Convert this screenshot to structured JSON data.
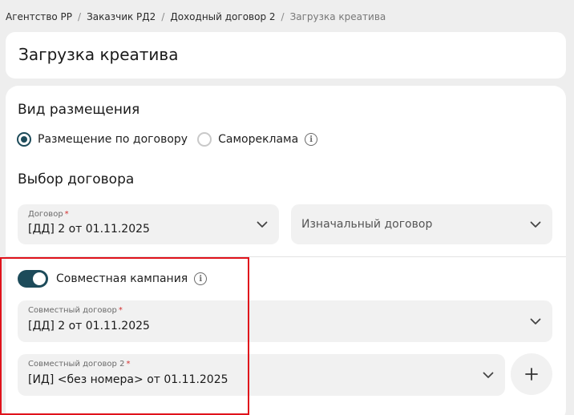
{
  "breadcrumb": {
    "items": [
      "Агентство РР",
      "Заказчик РД2",
      "Доходный договор 2"
    ],
    "current": "Загрузка креатива",
    "separator": "/"
  },
  "page_title": "Загрузка креатива",
  "placement": {
    "title": "Вид размещения",
    "options": [
      {
        "label": "Размещение по договору",
        "checked": true
      },
      {
        "label": "Самореклама",
        "checked": false
      }
    ]
  },
  "contract": {
    "title": "Выбор договора",
    "field": {
      "label": "Договор",
      "value": "[ДД] 2 от 01.11.2025"
    },
    "original_placeholder": "Изначальный договор"
  },
  "joint": {
    "toggle_label": "Совместная кампания",
    "toggle_on": true,
    "field1": {
      "label": "Совместный договор",
      "value": "[ДД] 2 от 01.11.2025"
    },
    "field2": {
      "label": "Совместный договор 2",
      "value": "[ИД] <без номера> от 01.11.2025"
    }
  },
  "required_mark": "*",
  "colors": {
    "accent": "#1d4b5a",
    "required": "#d32f2f",
    "highlight": "#e0121b"
  },
  "icons": {
    "info": "info-icon",
    "chevron": "chevron-down-icon",
    "plus": "plus-icon"
  }
}
